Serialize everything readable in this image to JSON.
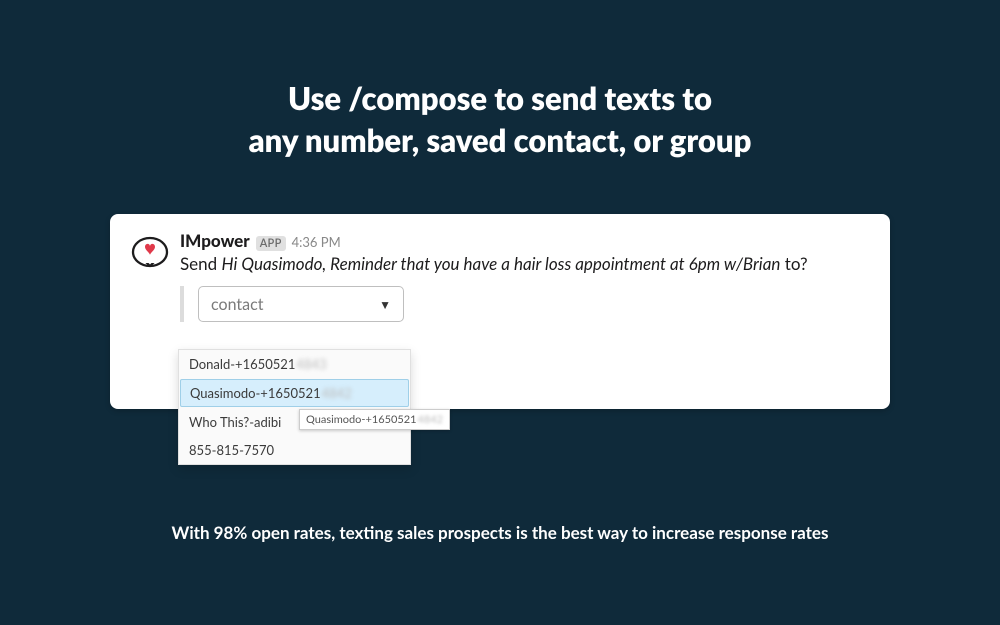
{
  "heading": {
    "line1": "Use /compose to send texts to",
    "line2": "any number, saved contact, or group"
  },
  "message": {
    "app_name": "IMpower",
    "app_badge": "APP",
    "timestamp": "4:36 PM",
    "send_prefix": "Send",
    "body_italic": "Hi Quasimodo, Reminder that you have a hair loss appointment at 6pm w/Brian",
    "to_suffix": "to?"
  },
  "select": {
    "label": "contact"
  },
  "dropdown": {
    "items": [
      {
        "label": "Donald-+1650521",
        "blur": "4843",
        "selected": false
      },
      {
        "label": "Quasimodo-+1650521",
        "blur": "4842",
        "selected": true
      },
      {
        "label": "Who This?-adibi",
        "blur": "",
        "selected": false
      },
      {
        "label": "855-815-7570",
        "blur": "",
        "selected": false
      }
    ],
    "tooltip": {
      "prefix": "Quasimodo-+1650521",
      "blur": "4842"
    }
  },
  "footer": "With 98% open rates, texting sales prospects is the best way to increase response rates"
}
